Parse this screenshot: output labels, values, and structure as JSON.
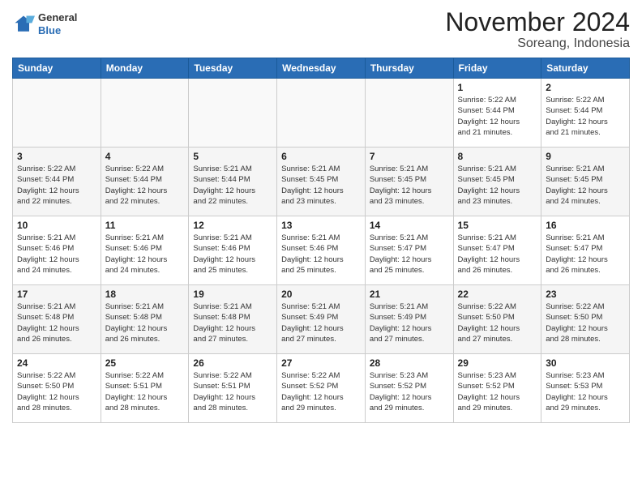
{
  "header": {
    "logo": {
      "line1": "General",
      "line2": "Blue"
    },
    "title": "November 2024",
    "subtitle": "Soreang, Indonesia"
  },
  "weekdays": [
    "Sunday",
    "Monday",
    "Tuesday",
    "Wednesday",
    "Thursday",
    "Friday",
    "Saturday"
  ],
  "weeks": [
    [
      {
        "day": "",
        "info": ""
      },
      {
        "day": "",
        "info": ""
      },
      {
        "day": "",
        "info": ""
      },
      {
        "day": "",
        "info": ""
      },
      {
        "day": "",
        "info": ""
      },
      {
        "day": "1",
        "info": "Sunrise: 5:22 AM\nSunset: 5:44 PM\nDaylight: 12 hours\nand 21 minutes."
      },
      {
        "day": "2",
        "info": "Sunrise: 5:22 AM\nSunset: 5:44 PM\nDaylight: 12 hours\nand 21 minutes."
      }
    ],
    [
      {
        "day": "3",
        "info": "Sunrise: 5:22 AM\nSunset: 5:44 PM\nDaylight: 12 hours\nand 22 minutes."
      },
      {
        "day": "4",
        "info": "Sunrise: 5:22 AM\nSunset: 5:44 PM\nDaylight: 12 hours\nand 22 minutes."
      },
      {
        "day": "5",
        "info": "Sunrise: 5:21 AM\nSunset: 5:44 PM\nDaylight: 12 hours\nand 22 minutes."
      },
      {
        "day": "6",
        "info": "Sunrise: 5:21 AM\nSunset: 5:45 PM\nDaylight: 12 hours\nand 23 minutes."
      },
      {
        "day": "7",
        "info": "Sunrise: 5:21 AM\nSunset: 5:45 PM\nDaylight: 12 hours\nand 23 minutes."
      },
      {
        "day": "8",
        "info": "Sunrise: 5:21 AM\nSunset: 5:45 PM\nDaylight: 12 hours\nand 23 minutes."
      },
      {
        "day": "9",
        "info": "Sunrise: 5:21 AM\nSunset: 5:45 PM\nDaylight: 12 hours\nand 24 minutes."
      }
    ],
    [
      {
        "day": "10",
        "info": "Sunrise: 5:21 AM\nSunset: 5:46 PM\nDaylight: 12 hours\nand 24 minutes."
      },
      {
        "day": "11",
        "info": "Sunrise: 5:21 AM\nSunset: 5:46 PM\nDaylight: 12 hours\nand 24 minutes."
      },
      {
        "day": "12",
        "info": "Sunrise: 5:21 AM\nSunset: 5:46 PM\nDaylight: 12 hours\nand 25 minutes."
      },
      {
        "day": "13",
        "info": "Sunrise: 5:21 AM\nSunset: 5:46 PM\nDaylight: 12 hours\nand 25 minutes."
      },
      {
        "day": "14",
        "info": "Sunrise: 5:21 AM\nSunset: 5:47 PM\nDaylight: 12 hours\nand 25 minutes."
      },
      {
        "day": "15",
        "info": "Sunrise: 5:21 AM\nSunset: 5:47 PM\nDaylight: 12 hours\nand 26 minutes."
      },
      {
        "day": "16",
        "info": "Sunrise: 5:21 AM\nSunset: 5:47 PM\nDaylight: 12 hours\nand 26 minutes."
      }
    ],
    [
      {
        "day": "17",
        "info": "Sunrise: 5:21 AM\nSunset: 5:48 PM\nDaylight: 12 hours\nand 26 minutes."
      },
      {
        "day": "18",
        "info": "Sunrise: 5:21 AM\nSunset: 5:48 PM\nDaylight: 12 hours\nand 26 minutes."
      },
      {
        "day": "19",
        "info": "Sunrise: 5:21 AM\nSunset: 5:48 PM\nDaylight: 12 hours\nand 27 minutes."
      },
      {
        "day": "20",
        "info": "Sunrise: 5:21 AM\nSunset: 5:49 PM\nDaylight: 12 hours\nand 27 minutes."
      },
      {
        "day": "21",
        "info": "Sunrise: 5:21 AM\nSunset: 5:49 PM\nDaylight: 12 hours\nand 27 minutes."
      },
      {
        "day": "22",
        "info": "Sunrise: 5:22 AM\nSunset: 5:50 PM\nDaylight: 12 hours\nand 27 minutes."
      },
      {
        "day": "23",
        "info": "Sunrise: 5:22 AM\nSunset: 5:50 PM\nDaylight: 12 hours\nand 28 minutes."
      }
    ],
    [
      {
        "day": "24",
        "info": "Sunrise: 5:22 AM\nSunset: 5:50 PM\nDaylight: 12 hours\nand 28 minutes."
      },
      {
        "day": "25",
        "info": "Sunrise: 5:22 AM\nSunset: 5:51 PM\nDaylight: 12 hours\nand 28 minutes."
      },
      {
        "day": "26",
        "info": "Sunrise: 5:22 AM\nSunset: 5:51 PM\nDaylight: 12 hours\nand 28 minutes."
      },
      {
        "day": "27",
        "info": "Sunrise: 5:22 AM\nSunset: 5:52 PM\nDaylight: 12 hours\nand 29 minutes."
      },
      {
        "day": "28",
        "info": "Sunrise: 5:23 AM\nSunset: 5:52 PM\nDaylight: 12 hours\nand 29 minutes."
      },
      {
        "day": "29",
        "info": "Sunrise: 5:23 AM\nSunset: 5:52 PM\nDaylight: 12 hours\nand 29 minutes."
      },
      {
        "day": "30",
        "info": "Sunrise: 5:23 AM\nSunset: 5:53 PM\nDaylight: 12 hours\nand 29 minutes."
      }
    ]
  ]
}
